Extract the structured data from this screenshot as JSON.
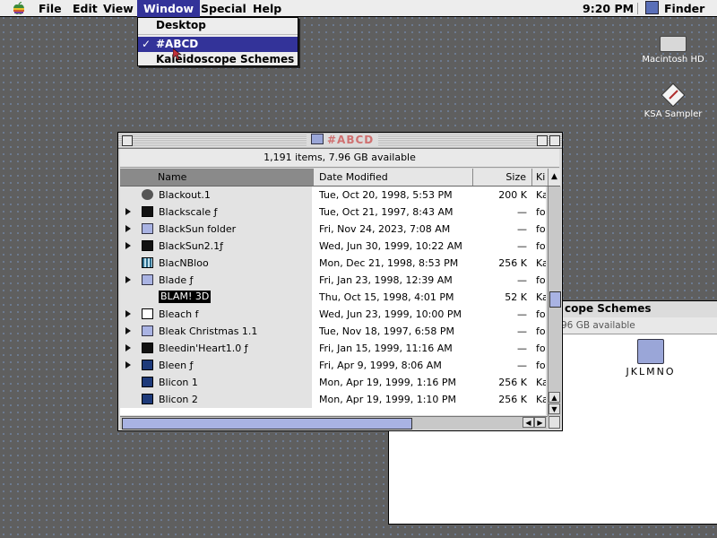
{
  "menubar": {
    "items": [
      "File",
      "Edit",
      "View",
      "Window",
      "Special",
      "Help"
    ],
    "active": "Window",
    "clock": "9:20 PM",
    "app": "Finder"
  },
  "window_menu": {
    "items": [
      {
        "label": "Desktop",
        "checked": false
      },
      {
        "label": "#ABCD",
        "checked": true
      },
      {
        "label": "Kaleidoscope Schemes",
        "checked": false
      }
    ],
    "check_mark": "✓"
  },
  "desktop_icons": [
    {
      "label": "Macintosh HD",
      "icon": "hard-disk-icon"
    },
    {
      "label": "KSA Sampler",
      "icon": "application-icon"
    }
  ],
  "background_window": {
    "title": "cope Schemes",
    "info": "96 GB available",
    "folder_label": "JKLMNO"
  },
  "main_window": {
    "title": "#ABCD",
    "info": "1,191 items, 7.96 GB available",
    "columns": {
      "name": "Name",
      "date": "Date Modified",
      "size": "Size",
      "kind": "Ki"
    },
    "rows": [
      {
        "name": "Blackout.1",
        "date": "Tue, Oct 20, 1998, 5:53 PM",
        "size": "200 K",
        "kind": "Ka",
        "icon": "apple",
        "folder": false,
        "highlight": false
      },
      {
        "name": "Blackscale ƒ",
        "date": "Tue, Oct 21, 1997, 8:43 AM",
        "size": "—",
        "kind": "fol",
        "icon": "black",
        "folder": true,
        "highlight": false
      },
      {
        "name": "BlackSun folder",
        "date": "Fri, Nov 24, 2023, 7:08 AM",
        "size": "—",
        "kind": "fol",
        "icon": "folder",
        "folder": true,
        "highlight": false
      },
      {
        "name": "BlackSun2.1ƒ",
        "date": "Wed, Jun 30, 1999, 10:22 AM",
        "size": "—",
        "kind": "fol",
        "icon": "black",
        "folder": true,
        "highlight": false
      },
      {
        "name": "BlacNBloo",
        "date": "Mon, Dec 21, 1998, 8:53 PM",
        "size": "256 K",
        "kind": "Ka",
        "icon": "stripe",
        "folder": false,
        "highlight": false
      },
      {
        "name": "Blade ƒ",
        "date": "Fri, Jan 23, 1998, 12:39 AM",
        "size": "—",
        "kind": "fol",
        "icon": "folder",
        "folder": true,
        "highlight": false
      },
      {
        "name": "BLAM! 3D",
        "date": "Thu, Oct 15, 1998, 4:01 PM",
        "size": "52 K",
        "kind": "Ka",
        "icon": "none",
        "folder": false,
        "highlight": true
      },
      {
        "name": "Bleach f",
        "date": "Wed, Jun 23, 1999, 10:00 PM",
        "size": "—",
        "kind": "fol",
        "icon": "doc",
        "folder": true,
        "highlight": false
      },
      {
        "name": "Bleak Christmas 1.1",
        "date": "Tue, Nov 18, 1997, 6:58 PM",
        "size": "—",
        "kind": "fol",
        "icon": "folder",
        "folder": true,
        "highlight": false
      },
      {
        "name": "Bleedin'Heart1.0 ƒ",
        "date": "Fri, Jan 15, 1999, 11:16 AM",
        "size": "—",
        "kind": "fol",
        "icon": "black",
        "folder": true,
        "highlight": false
      },
      {
        "name": "Bleen ƒ",
        "date": "Fri, Apr 9, 1999, 8:06 AM",
        "size": "—",
        "kind": "fol",
        "icon": "app",
        "folder": true,
        "highlight": false
      },
      {
        "name": "Blicon 1",
        "date": "Mon, Apr 19, 1999, 1:16 PM",
        "size": "256 K",
        "kind": "Ka",
        "icon": "app",
        "folder": false,
        "highlight": false
      },
      {
        "name": "Blicon 2",
        "date": "Mon, Apr 19, 1999, 1:10 PM",
        "size": "256 K",
        "kind": "Ka",
        "icon": "app",
        "folder": false,
        "highlight": false
      }
    ],
    "vscroll_position": 0.55,
    "hscroll_position": 0.0
  },
  "colors": {
    "menu_highlight": "#333399",
    "desktop": "#5f5f5f",
    "title_text": "#d07070"
  }
}
